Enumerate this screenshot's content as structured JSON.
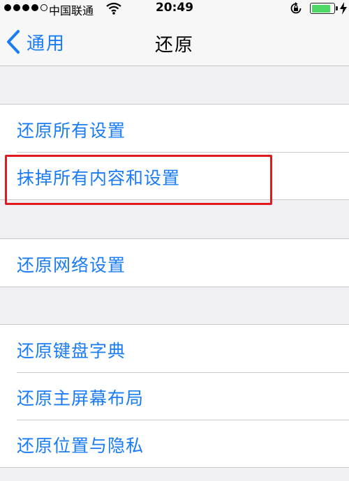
{
  "status_bar": {
    "carrier": "中国联通",
    "time": "20:49",
    "battery_level": 0.85,
    "signal_bars_filled": 4,
    "signal_bars_total": 5
  },
  "nav": {
    "back_label": "通用",
    "title": "还原"
  },
  "groups": [
    {
      "items": [
        "还原所有设置",
        "抹掉所有内容和设置"
      ]
    },
    {
      "items": [
        "还原网络设置"
      ]
    },
    {
      "items": [
        "还原键盘字典",
        "还原主屏幕布局",
        "还原位置与隐私"
      ]
    }
  ],
  "colors": {
    "accent": "#1a7cf5",
    "highlight": "#e0191f",
    "battery": "#4cd964",
    "background": "#efeff4"
  },
  "icons": {
    "back": "chevron-left-icon",
    "wifi": "wifi-icon",
    "rotation_lock": "rotation-lock-icon",
    "battery": "battery-icon",
    "charging": "charging-bolt-icon"
  }
}
